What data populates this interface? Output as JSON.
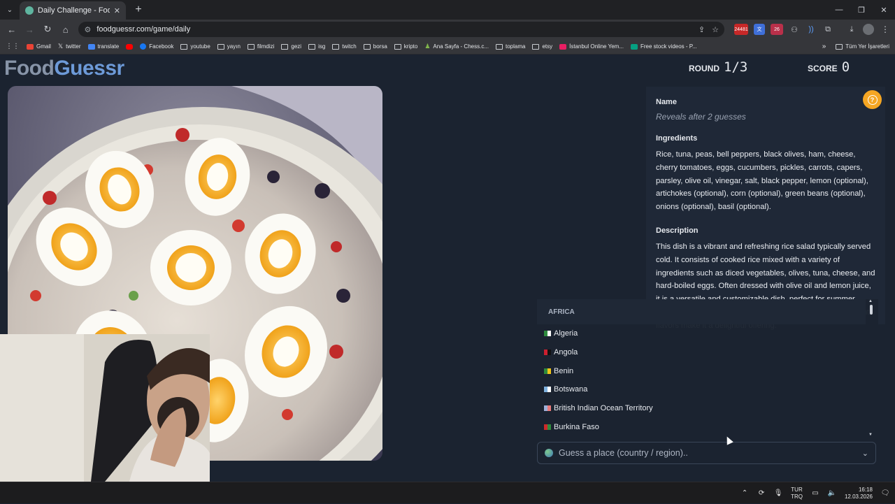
{
  "browser": {
    "tab_title": "Daily Challenge - FoodGuessr |",
    "url": "foodguessr.com/game/daily",
    "bookmarks": [
      "Gmail",
      "twitter",
      "translate",
      "Facebook",
      "youtube",
      "yayın",
      "filmdizi",
      "gezi",
      "isg",
      "twitch",
      "borsa",
      "kripto",
      "Ana Sayfa - Chess.c...",
      "toplama",
      "etsy",
      "İstanbul Online Yem...",
      "Free stock videos - P..."
    ],
    "bookmarks_all": "Tüm Yer İşaretleri",
    "ext_badge_1": "24481",
    "ext_badge_2": "26"
  },
  "header": {
    "logo_part1": "Food",
    "logo_part2": "Guessr",
    "round_label": "ROUND",
    "round_value": "1/3",
    "score_label": "SCORE",
    "score_value": "0"
  },
  "info": {
    "name_label": "Name",
    "name_value": "Reveals after 2 guesses",
    "ingredients_label": "Ingredients",
    "ingredients": "Rice, tuna, peas, bell peppers, black olives, ham, cheese, cherry tomatoes, eggs, cucumbers, pickles, carrots, capers, parsley, olive oil, vinegar, salt, black pepper, lemon (optional), artichokes (optional), corn (optional), green beans (optional), onions (optional), basil (optional).",
    "description_label": "Description",
    "description": "This dish is a vibrant and refreshing rice salad typically served cold. It consists of cooked rice mixed with a variety of ingredients such as diced vegetables, olives, tuna, cheese, and hard-boiled eggs. Often dressed with olive oil and lemon juice, it is a versatile and customizable dish, perfect for summer picnics or casual gatherings. Its colorful presentation and light flavors make it a delightful offering."
  },
  "dropdown": {
    "group": "AFRICA",
    "items": [
      {
        "label": "Algeria",
        "flag": [
          "#2e8b3e",
          "#ffffff"
        ]
      },
      {
        "label": "Angola",
        "flag": [
          "#cc1f2f",
          "#111111"
        ]
      },
      {
        "label": "Benin",
        "flag": [
          "#2f8a3c",
          "#f0c419"
        ]
      },
      {
        "label": "Botswana",
        "flag": [
          "#7fb2e0",
          "#ffffff"
        ]
      },
      {
        "label": "British Indian Ocean Territory",
        "flag": [
          "#9fb0d8",
          "#e87a7a"
        ]
      },
      {
        "label": "Burkina Faso",
        "flag": [
          "#cc2a2a",
          "#2e8b3e"
        ]
      }
    ]
  },
  "guess": {
    "placeholder": "Guess a place (country / region).."
  },
  "taskbar": {
    "lang_1": "TUR",
    "lang_2": "TRQ",
    "time": "16:18",
    "date": "12.03.2026"
  }
}
